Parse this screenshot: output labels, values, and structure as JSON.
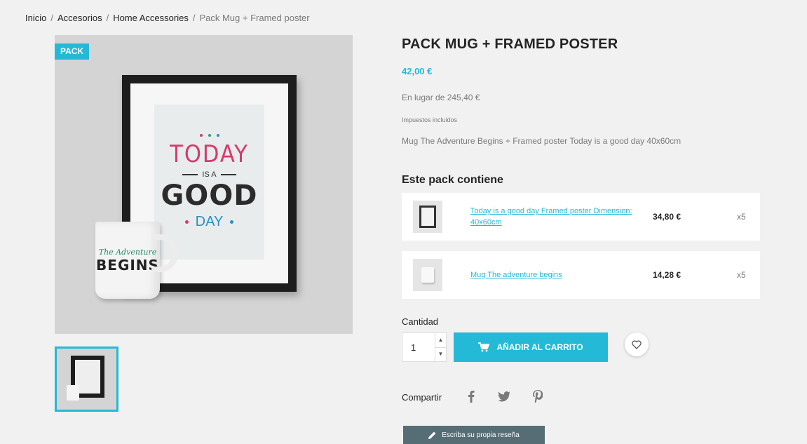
{
  "breadcrumb": {
    "items": [
      "Inicio",
      "Accesorios",
      "Home Accessories"
    ],
    "current": "Pack Mug + Framed poster",
    "separator": "/"
  },
  "product": {
    "flag": "PACK",
    "title": "PACK MUG + FRAMED POSTER",
    "price": "42,00 €",
    "regular_price": "En lugar de 245,40 €",
    "tax_label": "Impuestos incluidos",
    "description": "Mug The Adventure Begins + Framed poster Today is a good day 40x60cm",
    "image_art": {
      "today": "TODAY",
      "is_a": "IS A",
      "good": "GOOD",
      "day": "DAY",
      "mug_line1": "The Adventure",
      "mug_line2": "BEGINS"
    }
  },
  "pack": {
    "heading": "Este pack contiene",
    "items": [
      {
        "name": "Today is a good day Framed poster Dimension: 40x60cm",
        "price": "34,80 €",
        "qty": "x5",
        "thumb": "framed-poster"
      },
      {
        "name": "Mug The adventure begins",
        "price": "14,28 €",
        "qty": "x5",
        "thumb": "mug"
      }
    ]
  },
  "cart": {
    "quantity_label": "Cantidad",
    "quantity_value": "1",
    "add_to_cart": "AÑADIR AL CARRITO",
    "cart_icon": "cart-icon",
    "wishlist_icon": "heart-icon"
  },
  "share": {
    "label": "Compartir",
    "icons": [
      "facebook-icon",
      "twitter-icon",
      "pinterest-icon"
    ]
  },
  "review": {
    "label": "Escriba su propia reseña",
    "icon": "pencil-icon"
  },
  "colors": {
    "accent": "#24b9d7",
    "text": "#232323",
    "muted": "#7a7a7a",
    "background": "#f1f1f1",
    "review_button": "#576d75",
    "art_pink": "#d53a6b",
    "art_blue": "#2d8fc4"
  }
}
